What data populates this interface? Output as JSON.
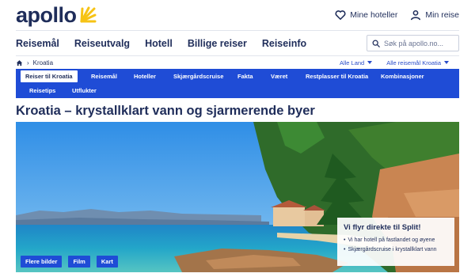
{
  "brand": {
    "name": "apollo",
    "accent": "#f6c315",
    "primary": "#1f4cd6",
    "text": "#1f2d5a"
  },
  "header": {
    "actions": [
      {
        "icon": "heart-icon",
        "label": "Mine hoteller"
      },
      {
        "icon": "user-icon",
        "label": "Min reise"
      }
    ]
  },
  "mainnav": {
    "items": [
      "Reisemål",
      "Reiseutvalg",
      "Hotell",
      "Billige reiser",
      "Reiseinfo"
    ],
    "search_placeholder": "Søk på apollo.no..."
  },
  "breadcrumb": {
    "home_icon": "home-icon",
    "current": "Kroatia"
  },
  "filters": {
    "country": "Alle Land",
    "destination": "Alle reisemål Kroatia"
  },
  "subnav": {
    "row1": [
      "Reiser til Kroatia",
      "Reisemål",
      "Hoteller",
      "Skjærgårdscruise",
      "Fakta",
      "Været",
      "Restplasser til Kroatia",
      "Kombinasjoner"
    ],
    "row2": [
      "Reisetips",
      "Utflukter"
    ],
    "active": "Reiser til Kroatia"
  },
  "page": {
    "title": "Kroatia – krystallklart vann og sjarmerende byer"
  },
  "hero": {
    "buttons": [
      "Flere bilder",
      "Film",
      "Kart"
    ],
    "promo": {
      "title": "Vi flyr direkte til Split!",
      "lines": [
        "Vi har hotell på fastlandet og øyene",
        "Skjærgårdscruise i krystallklart vann"
      ]
    }
  }
}
